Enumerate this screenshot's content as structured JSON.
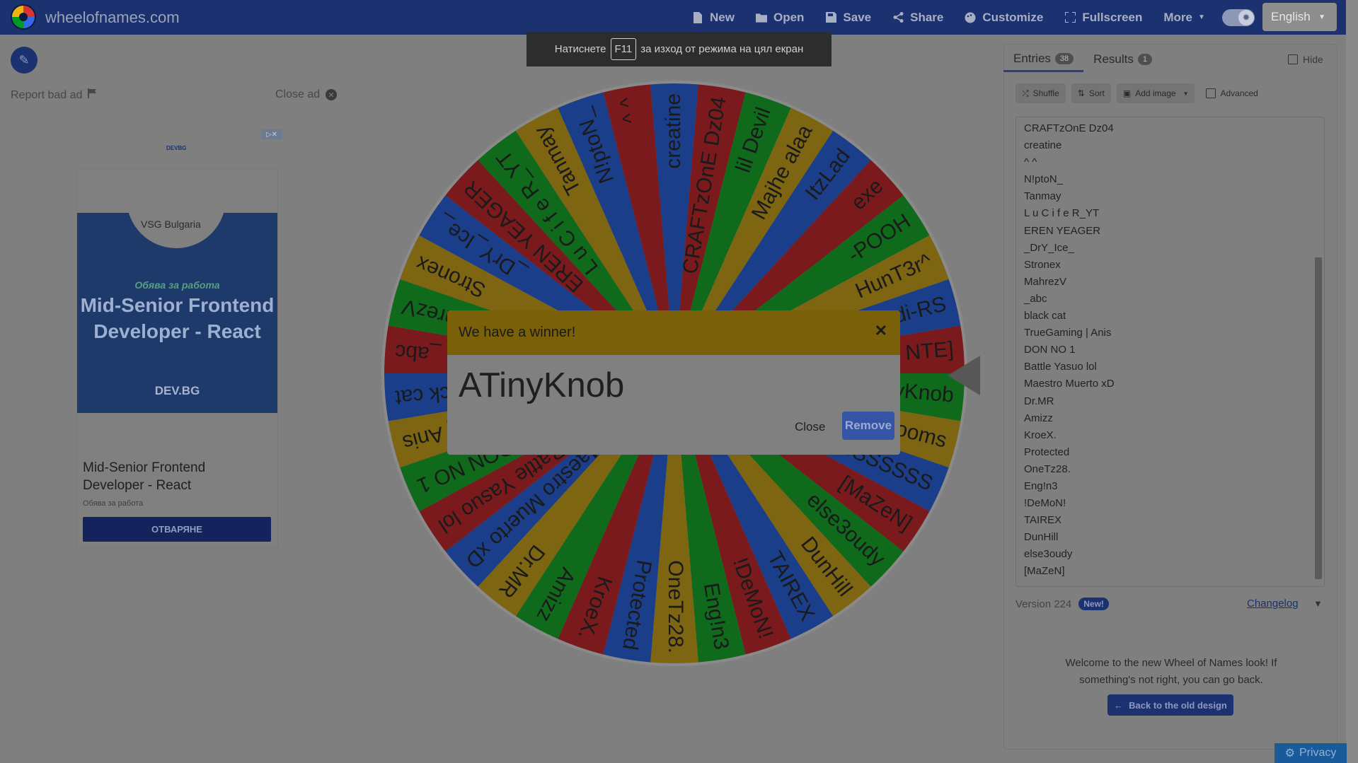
{
  "app": {
    "site_title": "wheelofnames.com"
  },
  "menu": [
    {
      "label": "New",
      "icon": "file-icon"
    },
    {
      "label": "Open",
      "icon": "folder-icon"
    },
    {
      "label": "Save",
      "icon": "save-icon"
    },
    {
      "label": "Share",
      "icon": "share-icon"
    },
    {
      "label": "Customize",
      "icon": "palette-icon"
    },
    {
      "label": "Fullscreen",
      "icon": "fullscreen-icon"
    },
    {
      "label": "More",
      "icon": "caret-down-icon"
    }
  ],
  "language": {
    "selected": "English"
  },
  "fullscreen_toast": {
    "before": "Натиснете",
    "key": "F11",
    "after": "за изход от режима на цял екран"
  },
  "ad": {
    "report_label": "Report bad ad",
    "close_label": "Close ad",
    "brand": "DEVBG",
    "image_company": "VSG Bulgaria",
    "image_kicker": "Обява за работа",
    "image_headline": "Mid-Senior Frontend Developer - React",
    "image_footer": "DEV.BG",
    "title": "Mid-Senior Frontend Developer - React",
    "subtitle": "Обява за работа",
    "cta": "ОТВАРЯНЕ"
  },
  "wheel": {
    "colors": [
      "#1b3e8a",
      "#7a1a1d",
      "#0f6a1c",
      "#7d6512"
    ],
    "segments": [
      "creatine",
      "CRAFTzOnE Dz04",
      "lil Devil",
      "Majhe alaa",
      "ItzLad",
      "exe",
      "-POOH",
      "HunT3r^",
      "Audi-RS",
      "NTE]",
      "ATinyKnob",
      "Mrtooms",
      "SSSSSSS",
      "[MaZeN]",
      "else3oudy",
      "DunHill",
      "TAIREX",
      "!DeMoN!",
      "Eng!n3",
      "OneTz28.",
      "Protected",
      "KroeX.",
      "Amizz",
      "Dr.MR",
      "Maestro Muerto xD",
      "Battle Yasuo lol",
      "DON NO 1",
      "| Anis",
      "lack cat",
      "_abc",
      "MahrezV",
      "Stronex",
      "_DrY_Ice_",
      "EREN YEAGER",
      "L u C i f e R_YT",
      "Tanmay",
      "N!ptoN_",
      "^ ^"
    ]
  },
  "modal": {
    "title": "We have a winner!",
    "winner": "ATinyKnob",
    "close_label": "Close",
    "remove_label": "Remove"
  },
  "panel": {
    "tabs": [
      {
        "label": "Entries",
        "count": "38"
      },
      {
        "label": "Results",
        "count": "1"
      }
    ],
    "hide_label": "Hide",
    "toolbar": {
      "shuffle": "Shuffle",
      "sort": "Sort",
      "add_image": "Add image",
      "advanced": "Advanced"
    },
    "entries": [
      "CRAFTzOnE Dz04",
      "creatine",
      "^ ^",
      "N!ptoN_",
      "Tanmay",
      "L u C i f e R_YT",
      "EREN YEAGER",
      "_DrY_Ice_",
      "Stronex",
      "MahrezV",
      "_abc",
      "black cat",
      "TrueGaming | Anis",
      "DON NO 1",
      "Battle Yasuo lol",
      "Maestro Muerto xD",
      "Dr.MR",
      "Amizz",
      "KroeX.",
      "Protected",
      "OneTz28.",
      "Eng!n3",
      "!DeMoN!",
      "TAIREX",
      "DunHill",
      "else3oudy",
      "[MaZeN]"
    ],
    "version": "Version 224",
    "new_badge": "New!",
    "changelog": "Changelog",
    "welcome": "Welcome to the new Wheel of Names look! If something's not right, you can go back.",
    "back_button": "Back to the old design"
  },
  "privacy": {
    "label": "Privacy"
  }
}
